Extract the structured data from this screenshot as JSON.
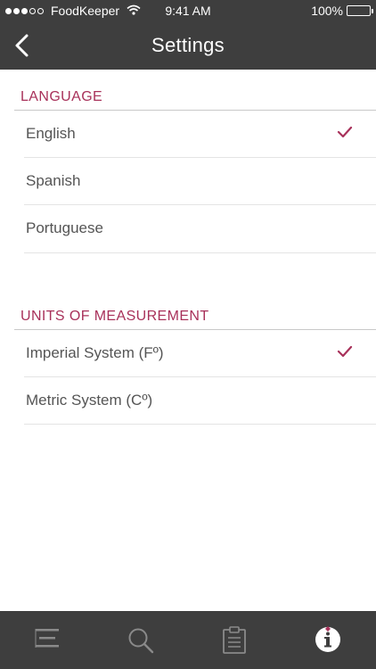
{
  "status_bar": {
    "carrier": "FoodKeeper",
    "time": "9:41 AM",
    "battery": "100%",
    "signal_icon": "signal-dots-icon",
    "wifi_icon": "wifi-icon",
    "battery_icon": "battery-icon"
  },
  "nav": {
    "title": "Settings",
    "back_icon": "chevron-left-icon"
  },
  "language": {
    "header": "LANGUAGE",
    "items": [
      {
        "label": "English",
        "selected": true
      },
      {
        "label": "Spanish",
        "selected": false
      },
      {
        "label": "Portuguese",
        "selected": false
      }
    ]
  },
  "units": {
    "header": "UNITS OF MEASUREMENT",
    "items": [
      {
        "label": "Imperial System (Fº)",
        "selected": true
      },
      {
        "label": "Metric System (Cº)",
        "selected": false
      }
    ]
  },
  "tabbar": {
    "tabs": [
      {
        "icon": "list-icon",
        "active": false
      },
      {
        "icon": "search-icon",
        "active": false
      },
      {
        "icon": "clipboard-icon",
        "active": false
      },
      {
        "icon": "info-icon",
        "active": true
      }
    ]
  },
  "colors": {
    "accent": "#a8315a",
    "bar": "#3e3e3e",
    "text": "#555555"
  }
}
